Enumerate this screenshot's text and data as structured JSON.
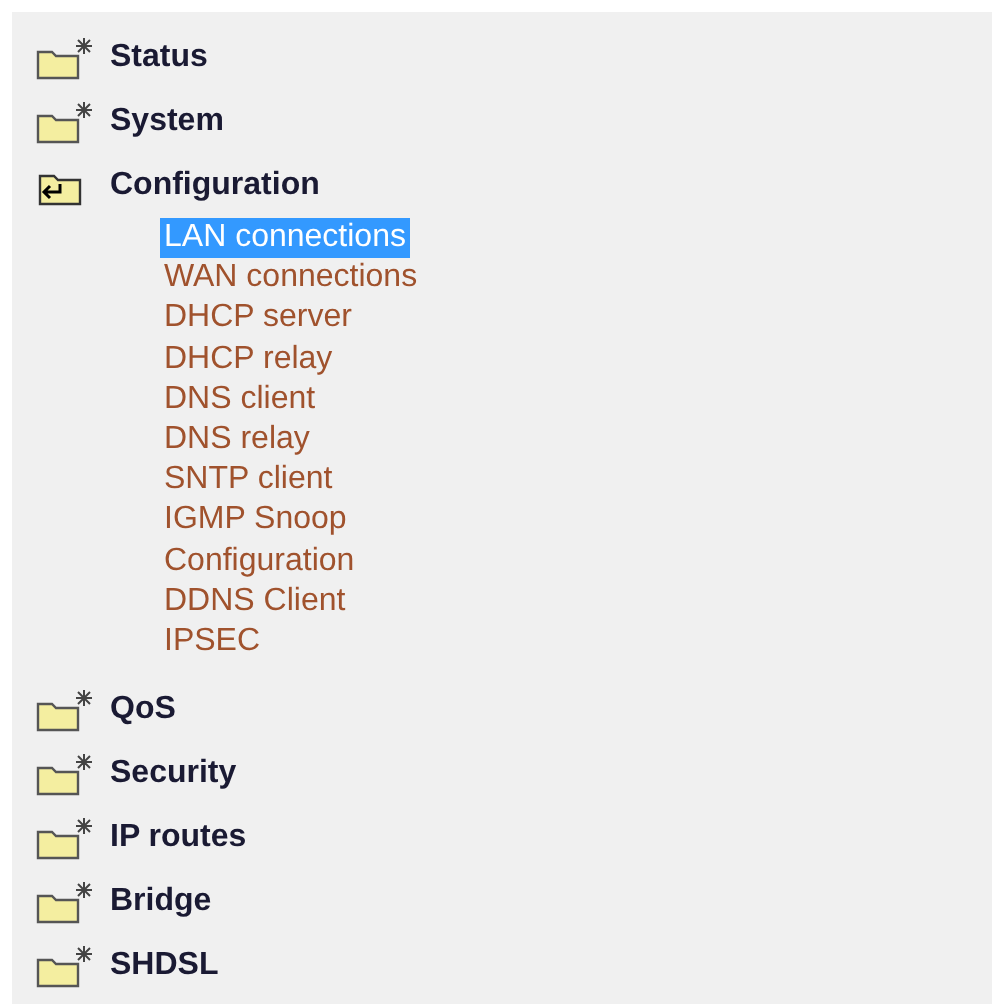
{
  "menu": [
    {
      "label": "Status",
      "expanded": false
    },
    {
      "label": "System",
      "expanded": false
    },
    {
      "label": "Configuration",
      "expanded": true,
      "children": [
        {
          "label": "LAN connections",
          "selected": true
        },
        {
          "label": "WAN connections",
          "selected": false
        },
        {
          "label": "DHCP server",
          "selected": false
        },
        {
          "label": "DHCP relay",
          "selected": false
        },
        {
          "label": "DNS client",
          "selected": false
        },
        {
          "label": "DNS relay",
          "selected": false
        },
        {
          "label": "SNTP client",
          "selected": false
        },
        {
          "label": "IGMP Snoop",
          "selected": false
        },
        {
          "label": "Configuration",
          "selected": false
        },
        {
          "label": "DDNS Client",
          "selected": false
        },
        {
          "label": "IPSEC",
          "selected": false
        }
      ]
    },
    {
      "label": "QoS",
      "expanded": false
    },
    {
      "label": "Security",
      "expanded": false
    },
    {
      "label": "IP routes",
      "expanded": false
    },
    {
      "label": "Bridge",
      "expanded": false
    },
    {
      "label": "SHDSL",
      "expanded": false
    }
  ]
}
